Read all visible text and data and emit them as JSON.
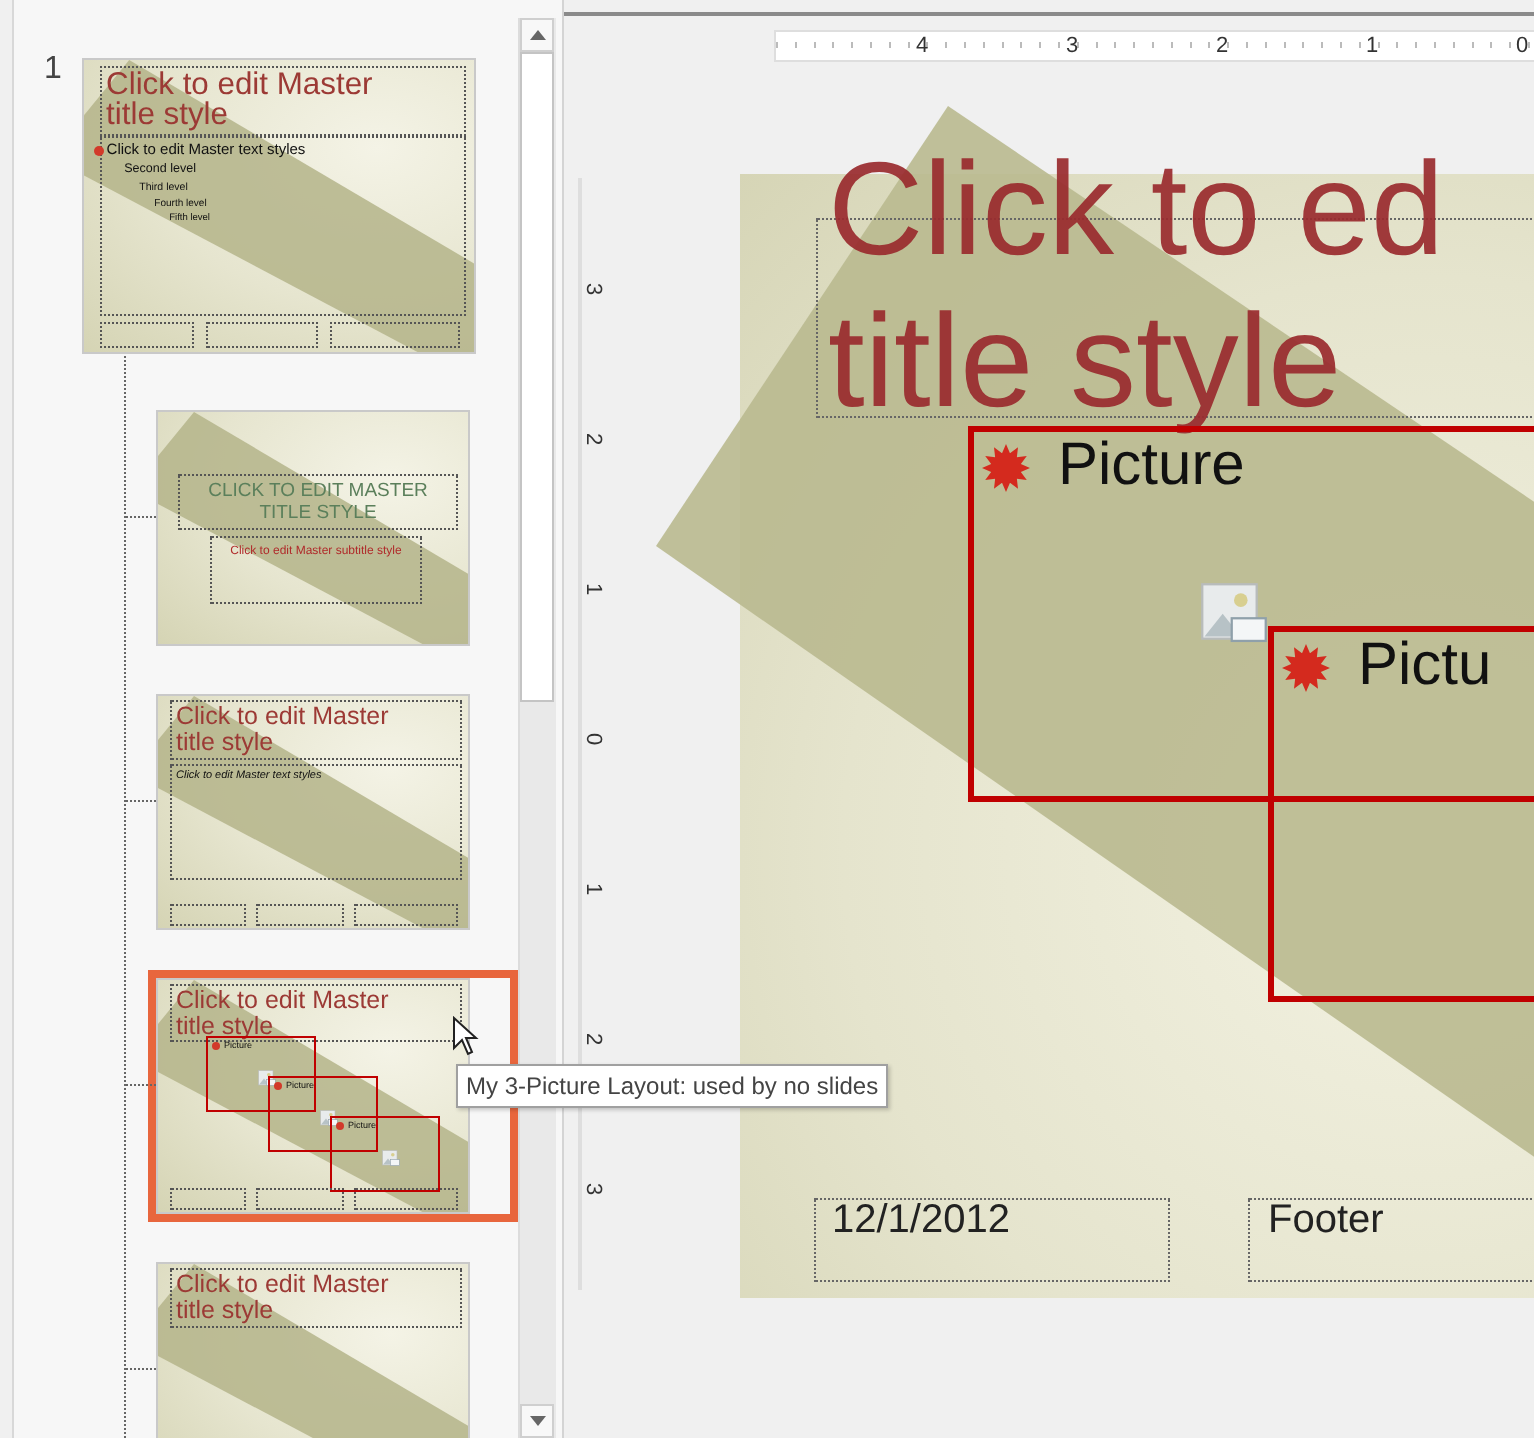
{
  "slide_number": "1",
  "thumbnails": [
    {
      "kind": "master",
      "selected": false,
      "title": "Click to edit Master title style",
      "levels": [
        "Click to edit Master text styles",
        "Second level",
        "Third level",
        "Fourth level",
        "Fifth level"
      ]
    },
    {
      "kind": "title",
      "selected": false,
      "title": "CLICK TO EDIT MASTER TITLE STYLE",
      "subtitle": "Click to edit Master subtitle style"
    },
    {
      "kind": "content",
      "selected": false,
      "title": "Click to edit Master title style",
      "body": "Click to edit Master text styles"
    },
    {
      "kind": "three_picture",
      "selected": true,
      "title": "Click to edit Master title style",
      "pictures": [
        "Picture",
        "Picture",
        "Picture"
      ]
    },
    {
      "kind": "title_only",
      "selected": false,
      "title": "Click to edit Master title style"
    }
  ],
  "tooltip": "My 3-Picture Layout: used by no slides",
  "horizontal_ruler": [
    "4",
    "3",
    "2",
    "1",
    "0"
  ],
  "vertical_ruler": [
    "3",
    "2",
    "1",
    "0",
    "1",
    "2",
    "3"
  ],
  "slide": {
    "title_lines": [
      "Click to ed",
      "title style"
    ],
    "pictures": [
      "Picture",
      "Pictu"
    ],
    "date": "12/1/2012",
    "footer": "Footer"
  }
}
